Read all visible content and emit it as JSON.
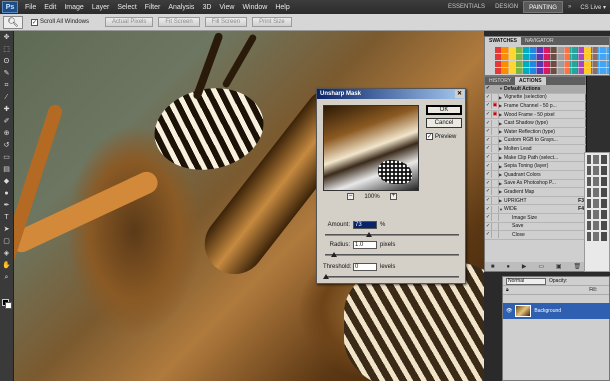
{
  "app": {
    "logo": "Ps"
  },
  "menu": [
    "File",
    "Edit",
    "Image",
    "Layer",
    "Select",
    "Filter",
    "Analysis",
    "3D",
    "View",
    "Window",
    "Help"
  ],
  "workspaces": {
    "essentials": "ESSENTIALS",
    "design": "DESIGN",
    "painting": "PAINTING",
    "more": "»",
    "cslive": "CS Live ▾"
  },
  "options": {
    "scroll_all": "Scroll All Windows",
    "actual": "Actual Pixels",
    "fit": "Fit Screen",
    "fill": "Fill Screen",
    "print": "Print Size"
  },
  "dialog": {
    "title": "Unsharp Mask",
    "ok": "OK",
    "cancel": "Cancel",
    "preview": "Preview",
    "zoom": "100%",
    "amount_label": "Amount:",
    "amount_value": "73",
    "amount_unit": "%",
    "radius_label": "Radius:",
    "radius_value": "1.0",
    "radius_unit": "pixels",
    "threshold_label": "Threshold:",
    "threshold_value": "0",
    "threshold_unit": "levels"
  },
  "swatches": {
    "tab1": "SWATCHES",
    "tab2": "NAVIGATOR"
  },
  "actions": {
    "tab1": "HISTORY",
    "tab2": "ACTIONS",
    "items": [
      {
        "name": "Default Actions",
        "head": true,
        "red": false,
        "fkey": ""
      },
      {
        "name": "Vignette (selection)",
        "red": false,
        "fkey": ""
      },
      {
        "name": "Frame Channel - 50 p...",
        "red": true,
        "fkey": ""
      },
      {
        "name": "Wood Frame - 50 pixel",
        "red": true,
        "fkey": ""
      },
      {
        "name": "Cast Shadow (type)",
        "red": false,
        "fkey": ""
      },
      {
        "name": "Water Reflection (type)",
        "red": false,
        "fkey": ""
      },
      {
        "name": "Custom RGB to Grays...",
        "red": false,
        "fkey": ""
      },
      {
        "name": "Molten Lead",
        "red": false,
        "fkey": ""
      },
      {
        "name": "Make Clip Path (select...",
        "red": false,
        "fkey": ""
      },
      {
        "name": "Sepia Toning (layer)",
        "red": false,
        "fkey": ""
      },
      {
        "name": "Quadrant Colors",
        "red": false,
        "fkey": ""
      },
      {
        "name": "Save As Photoshop P...",
        "red": false,
        "fkey": ""
      },
      {
        "name": "Gradient Map",
        "red": false,
        "fkey": ""
      },
      {
        "name": "UPRIGHT",
        "red": false,
        "fkey": "F3"
      },
      {
        "name": "WIDE",
        "red": false,
        "fkey": "F4",
        "open": true
      },
      {
        "name": "Image Size",
        "sub": true,
        "red": false,
        "fkey": ""
      },
      {
        "name": "Save",
        "sub": true,
        "red": false,
        "fkey": ""
      },
      {
        "name": "Close",
        "sub": true,
        "red": false,
        "fkey": ""
      }
    ]
  },
  "layers": {
    "blend": "Normal",
    "opacity_label": "Opacity:",
    "fill_label": "Fill:",
    "layer_name": "Background"
  }
}
